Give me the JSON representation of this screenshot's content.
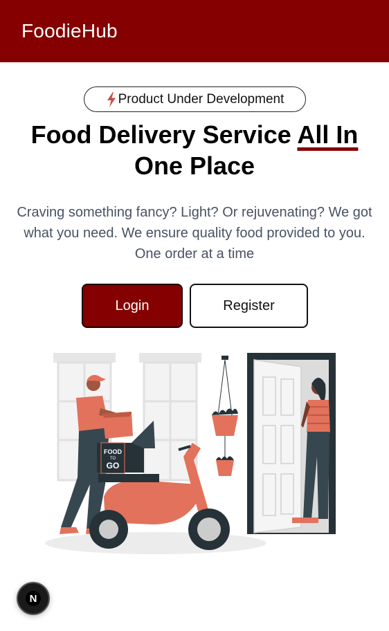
{
  "header": {
    "brand": "FoodieHub"
  },
  "hero": {
    "badge_label": "Product Under Development",
    "headline_part1": "Food Delivery Service ",
    "headline_accent": "All In",
    "headline_part2": "One Place",
    "description": "Craving something fancy? Light? Or rejuvenating? We got what you need. We ensure quality food provided to you. One order at a time",
    "login_label": "Login",
    "register_label": "Register"
  },
  "illustration": {
    "box_text_line1": "FOOD",
    "box_text_line2": "TO",
    "box_text_line3": "GO"
  },
  "dev_indicator": {
    "letter": "N"
  },
  "colors": {
    "brand": "#850000",
    "accent_orange": "#e2725b",
    "text_muted": "#475263",
    "dark": "#263238"
  },
  "icons": {
    "badge_icon": "lightning-bolt-icon",
    "dev_icon": "nextjs-logo-icon"
  }
}
